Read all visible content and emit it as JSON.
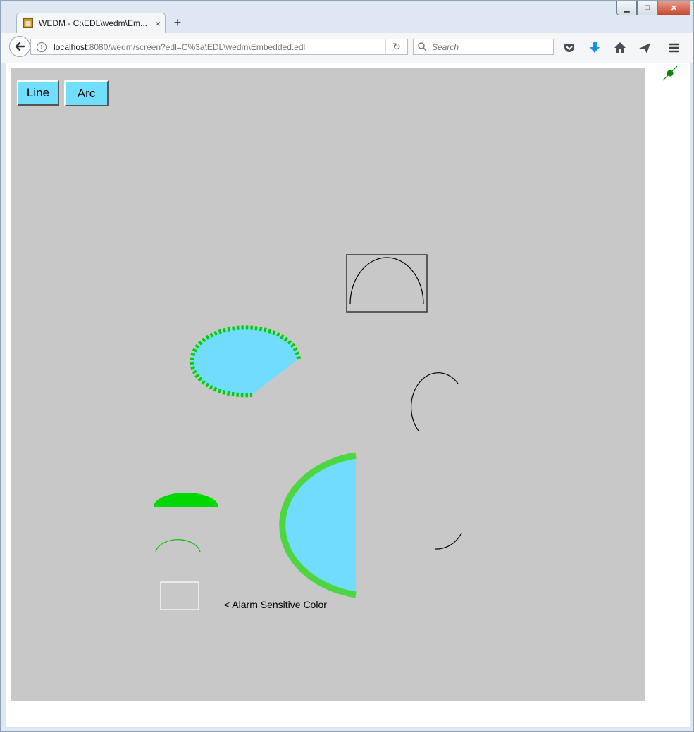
{
  "browser": {
    "tab_title": "WEDM - C:\\EDL\\wedm\\Em...",
    "tab_close": "×",
    "new_tab": "+",
    "url_host": "localhost",
    "url_rest": ":8080/wedm/screen?edl=C%3a\\EDL\\wedm\\Embedded.edl",
    "search_placeholder": "Search",
    "window_controls": {
      "minimize": "▁",
      "maximize": "□",
      "close": "✕"
    }
  },
  "screen": {
    "buttons": [
      {
        "label": "Line"
      },
      {
        "label": "Arc"
      }
    ],
    "alarm_label": "< Alarm Sensitive Color",
    "colors": {
      "background": "#c8c8c8",
      "button_fill": "#72deff",
      "arc_fill": "#72dcff",
      "alarm_green": "#00d800",
      "edge_green": "#4cd640",
      "outline": "#000000",
      "rect_outline": "#ffffff"
    }
  }
}
